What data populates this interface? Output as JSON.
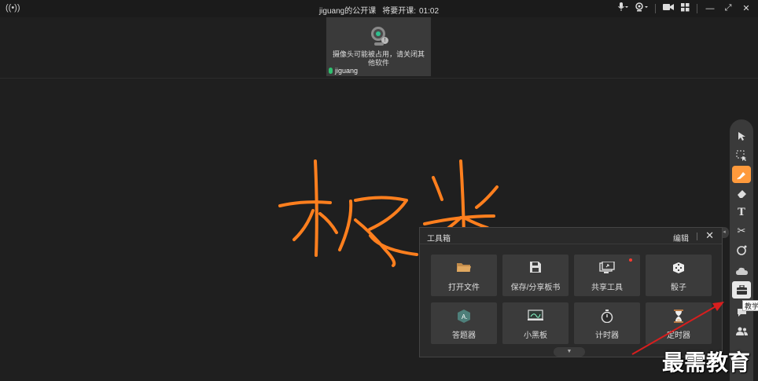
{
  "topbar": {
    "broadcast_icon": "broadcast-icon",
    "class_name": "jiguang的公开课",
    "countdown_label": "将要开课:",
    "countdown_time": "01:02",
    "mic_icon": "microphone-icon",
    "camera_icon": "webcam-icon",
    "video_icon": "video-camera-icon",
    "layout_icon": "grid-layout-icon",
    "minimize": "—",
    "restore": "⤢",
    "close": "✕"
  },
  "video_tile": {
    "message": "摄像头可能被占用，请关闭其他软件",
    "user_name": "jiguang"
  },
  "drawing": {
    "stroke_color": "#ff7f1e"
  },
  "toolbox": {
    "title": "工具箱",
    "edit_label": "编辑",
    "close_label": "✕",
    "items": [
      {
        "label": "打开文件",
        "icon": "folder-icon"
      },
      {
        "label": "保存/分享板书",
        "icon": "save-icon"
      },
      {
        "label": "共享工具",
        "icon": "share-screen-icon",
        "badge": true
      },
      {
        "label": "骰子",
        "icon": "dice-icon"
      },
      {
        "label": "答题器",
        "icon": "answer-card-icon"
      },
      {
        "label": "小黑板",
        "icon": "blackboard-icon"
      },
      {
        "label": "计时器",
        "icon": "stopwatch-icon"
      },
      {
        "label": "定时器",
        "icon": "hourglass-icon"
      }
    ]
  },
  "right_toolbar": {
    "tools": [
      "pointer-icon",
      "select-area-icon",
      "brush-icon",
      "eraser-icon",
      "text-icon",
      "scissors-icon",
      "laser-icon",
      "cloud-icon",
      "toolbox-icon",
      "chat-icon",
      "users-icon"
    ],
    "tooltip": "教学"
  },
  "watermark": "最需教育",
  "colors": {
    "accent": "#ff9a3c",
    "background": "#1f1f1f",
    "arrow": "#d81e1e"
  }
}
